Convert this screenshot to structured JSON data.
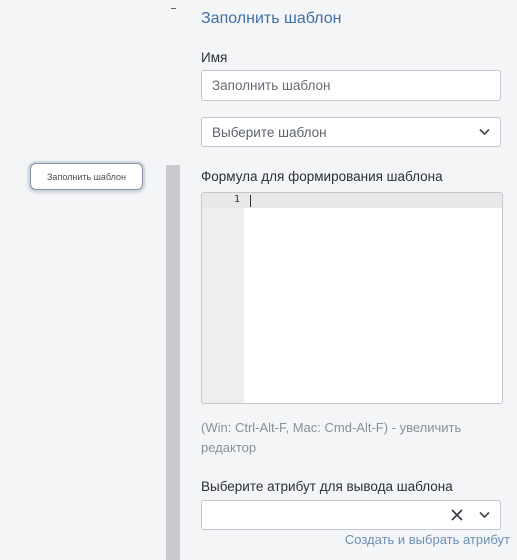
{
  "canvas": {
    "node_button_label": "Заполнить шаблон"
  },
  "panel": {
    "title": "Заполнить шаблон",
    "name_label": "Имя",
    "name_value": "Заполнить шаблон",
    "template_select_placeholder": "Выберите шаблон",
    "formula_label": "Формула для формирования шаблона",
    "editor": {
      "line_numbers": [
        "1"
      ],
      "content": ""
    },
    "editor_hint": "(Win: Ctrl-Alt-F, Mac: Cmd-Alt-F) - увеличить редактор",
    "attribute_label": "Выберите атрибут для вывода шаблона",
    "attribute_value": "",
    "create_attribute_link": "Создать и выбрать атрибут"
  },
  "icons": {
    "chevron": "chevron-down-icon",
    "clear": "close-icon"
  },
  "colors": {
    "title": "#3f6fa8",
    "link": "#6d8fb6",
    "hint": "#8a9099",
    "border": "#c4c8ce",
    "background": "#f4f5f7"
  }
}
